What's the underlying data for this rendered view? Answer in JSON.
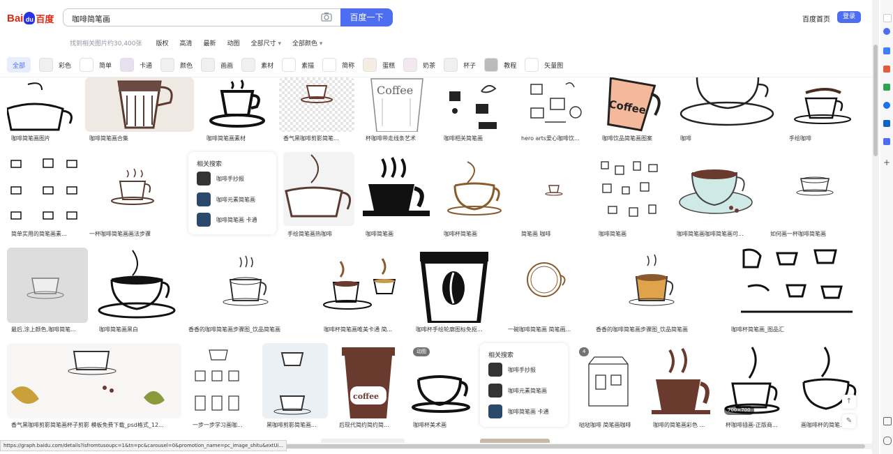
{
  "logo": {
    "bai": "Bai",
    "du": "du",
    "text": "百度"
  },
  "search": {
    "query": "咖啡简笔画",
    "button": "百度一下"
  },
  "header": {
    "home": "百度首页",
    "login": "登录"
  },
  "filters": {
    "count": "找到相关图片约30,400张",
    "items": [
      "版权",
      "高清",
      "最新",
      "动图"
    ],
    "dropdowns": [
      "全部尺寸",
      "全部颜色"
    ]
  },
  "tags": [
    "全部",
    "彩色",
    "简单",
    "卡通",
    "颜色",
    "画画",
    "素材",
    "素描",
    "简称",
    "蛋糕",
    "奶茶",
    "杯子",
    "教程",
    "矢量图"
  ],
  "row1": [
    "咖啡简笔画图片",
    "咖啡简笔画合集",
    "咖啡简笔画素材",
    "香气黑咖啡剪影简笔...",
    "杯咖啡带走线条艺术",
    "咖啡相关简笔画",
    "hero arts爱心咖啡饮...",
    "咖啡饮品简笔画图案",
    "咖啡",
    "手绘咖啡"
  ],
  "row2": [
    "简单实用的简笔画素...",
    "一杯咖啡简笔画画法步骤",
    "手绘简笔画热咖啡",
    "咖啡简笔画",
    "咖啡杯简笔画",
    "简笔画 咖啡",
    "咖啡简笔画",
    "咖啡简笔画咖啡简笔画可...",
    "如何画一杯咖啡简笔画"
  ],
  "related1": {
    "title": "相关搜索",
    "items": [
      "咖啡手抄报",
      "咖啡元素简笔画",
      "咖啡简笔画 卡通"
    ]
  },
  "row3": [
    "最后,涂上颜色,咖啡简笔...",
    "咖啡简笔画黑白",
    "香香的咖啡简笔画步骤图_饮品简笔画",
    "咖啡杯简笔画唯美卡通 简...",
    "咖啡杯手绘轮廓图标免抠...",
    "一碗咖啡简笔画 简笔画...",
    "香香的咖啡简笔画步骤图_饮品简笔画",
    "咖啡杯简笔画_图品汇"
  ],
  "row4": [
    "香气黑咖啡剪影简笔画杯子剪影 模板免费下载_psd格式_12...",
    "一步一步学习画咖...",
    "黑咖啡剪影简笔画...",
    "后现代简约简约简...",
    "咖啡杯美术画",
    "哒哒咖啡 简笔画咖啡",
    "咖啡的简笔画彩色 ...",
    "杯咖啡插画-正版商...",
    "画咖啡杯的简笔..."
  ],
  "related2": {
    "title": "相关搜索",
    "items": [
      "咖啡手抄报",
      "咖啡元素简笔画",
      "咖啡简笔画 卡通"
    ]
  },
  "badges": {
    "gif": "动图",
    "set": "4",
    "wm": "700×700"
  },
  "cup_texts": {
    "coffee1": "Coffee",
    "coffee2": "Coffee",
    "coffee3": "coffee"
  },
  "status_url": "https://graph.baidu.com/details?isfromtusoupc=1&tn=pc&carousel=0&promotion_name=pc_image_shitu&extUi...",
  "colors": {
    "brand_blue": "#4e6ef2",
    "brand_red": "#de2910"
  }
}
